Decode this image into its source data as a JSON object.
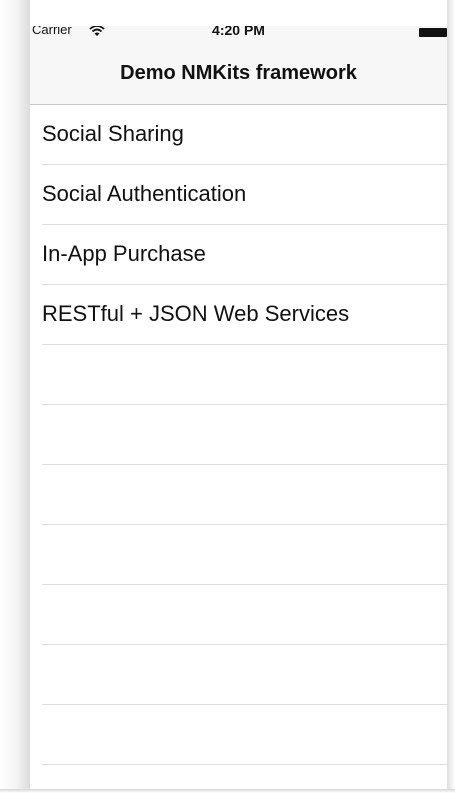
{
  "status_bar": {
    "carrier": "Carrier",
    "time": "4:20 PM",
    "wifi_icon": "wifi-icon",
    "battery_icon": "battery-icon"
  },
  "navbar": {
    "title": "Demo NMKits framework"
  },
  "list": {
    "items": [
      {
        "label": "Social Sharing"
      },
      {
        "label": "Social Authentication"
      },
      {
        "label": "In-App Purchase"
      },
      {
        "label": "RESTful + JSON Web Services"
      },
      {
        "label": ""
      },
      {
        "label": ""
      },
      {
        "label": ""
      },
      {
        "label": ""
      },
      {
        "label": ""
      },
      {
        "label": ""
      },
      {
        "label": ""
      }
    ]
  },
  "colors": {
    "navbar_bg": "#f7f7f7",
    "separator": "#dedede",
    "text": "#111111"
  }
}
